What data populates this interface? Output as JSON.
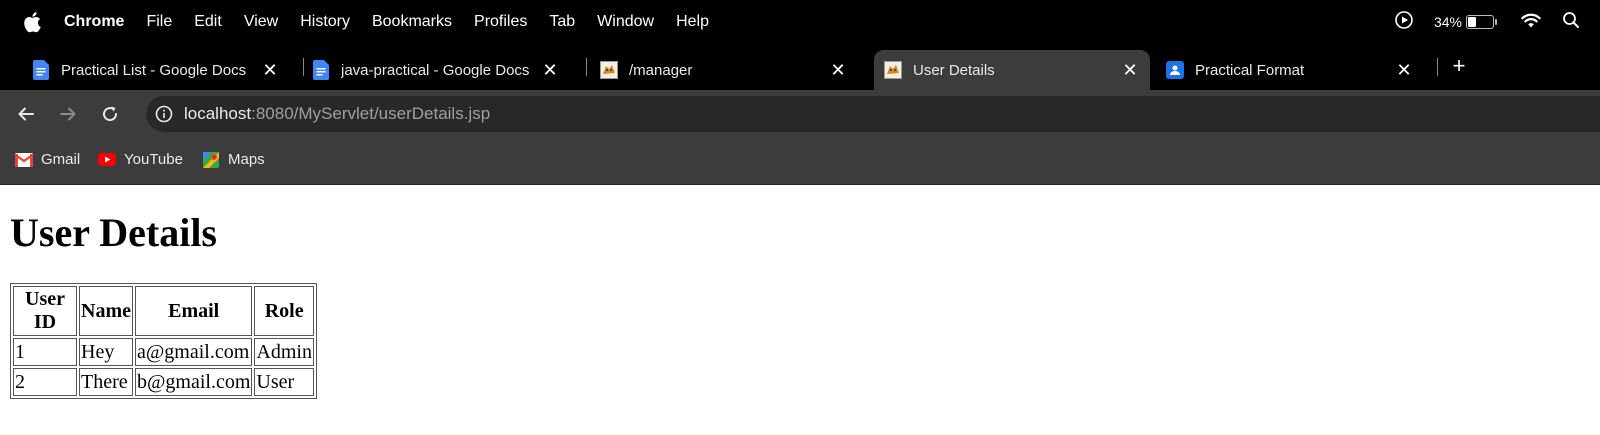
{
  "menubar": {
    "app": "Chrome",
    "items": [
      "File",
      "Edit",
      "View",
      "History",
      "Bookmarks",
      "Profiles",
      "Tab",
      "Window",
      "Help"
    ],
    "battery_percent": "34%",
    "battery_level": 0.34
  },
  "tabs": [
    {
      "title": "Practical List - Google Docs",
      "icon": "google-docs-icon",
      "active": false
    },
    {
      "title": "java-practical - Google Docs",
      "icon": "google-docs-icon",
      "active": false
    },
    {
      "title": "/manager",
      "icon": "tomcat-icon",
      "active": false
    },
    {
      "title": "User Details",
      "icon": "tomcat-icon",
      "active": true
    },
    {
      "title": "Practical Format",
      "icon": "google-classroom-icon",
      "active": false
    }
  ],
  "address": {
    "host": "localhost",
    "rest": ":8080/MyServlet/userDetails.jsp"
  },
  "bookmarks": [
    {
      "label": "Gmail",
      "icon": "gmail-icon"
    },
    {
      "label": "YouTube",
      "icon": "youtube-icon"
    },
    {
      "label": "Maps",
      "icon": "maps-icon"
    }
  ],
  "page": {
    "heading": "User Details",
    "table": {
      "headers": [
        "User ID",
        "Name",
        "Email",
        "Role"
      ],
      "rows": [
        [
          "1",
          "Hey",
          "a@gmail.com",
          "Admin"
        ],
        [
          "2",
          "There",
          "b@gmail.com",
          "User"
        ]
      ]
    }
  },
  "colors": {
    "menubar_bg": "#000000",
    "toolbar_bg": "#3c3c3c",
    "omnibox_bg": "#282828",
    "page_bg": "#ffffff"
  }
}
